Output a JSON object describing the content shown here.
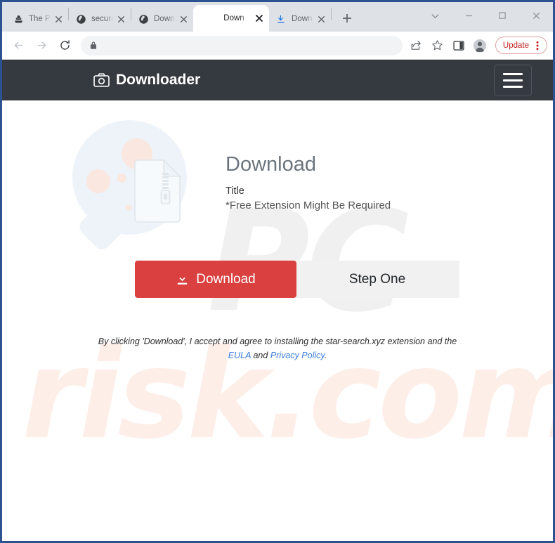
{
  "browser": {
    "tabs": [
      {
        "title": "The Pi",
        "favicon": "pirate-ship-icon",
        "active": false
      },
      {
        "title": "secure",
        "favicon": "globe-icon",
        "active": false
      },
      {
        "title": "Down",
        "favicon": "globe-icon",
        "active": false
      },
      {
        "title": "Down",
        "favicon": "none",
        "active": true
      },
      {
        "title": "Down",
        "favicon": "download-icon",
        "active": false
      }
    ],
    "new_tab_label": "+",
    "window_controls": {
      "tab_search": "tab-search-chevron-icon",
      "minimize": "minimize-icon",
      "maximize": "maximize-icon",
      "close": "close-icon"
    },
    "toolbar": {
      "back": "back-arrow-icon",
      "forward": "forward-arrow-icon",
      "reload": "reload-icon",
      "lock": "lock-icon",
      "url_value": "",
      "url_placeholder": "",
      "share": "share-icon",
      "bookmark": "star-icon",
      "side_panel": "side-panel-icon",
      "profile": "profile-avatar-icon",
      "update_label": "Update",
      "menu": "three-dot-menu-icon"
    }
  },
  "site": {
    "header": {
      "logo_icon": "camera-icon",
      "brand": "Downloader",
      "menu_toggle": "hamburger-icon"
    },
    "hero": {
      "illustration": "magnifier-with-zip-file-icon",
      "title": "Download",
      "subtitle": "Title",
      "note": "*Free Extension Might Be Required",
      "download_button": "Download",
      "download_button_icon": "download-icon",
      "step_button": "Step One"
    },
    "legal": {
      "line1": "By clicking 'Download', I accept and agree to installing the star-search.xyz extension and the",
      "eula": "EULA",
      "and": "and",
      "privacy": "Privacy Policy",
      "period": "."
    },
    "watermark": {
      "top": "PC",
      "bottom": "risk.com"
    }
  },
  "colors": {
    "window_border": "#2d5292",
    "header_bg": "#343a40",
    "download_red": "#d9403f",
    "step_gray": "#f1f1f1",
    "link_blue": "#3b7ddd",
    "update_red": "#c5221f"
  }
}
